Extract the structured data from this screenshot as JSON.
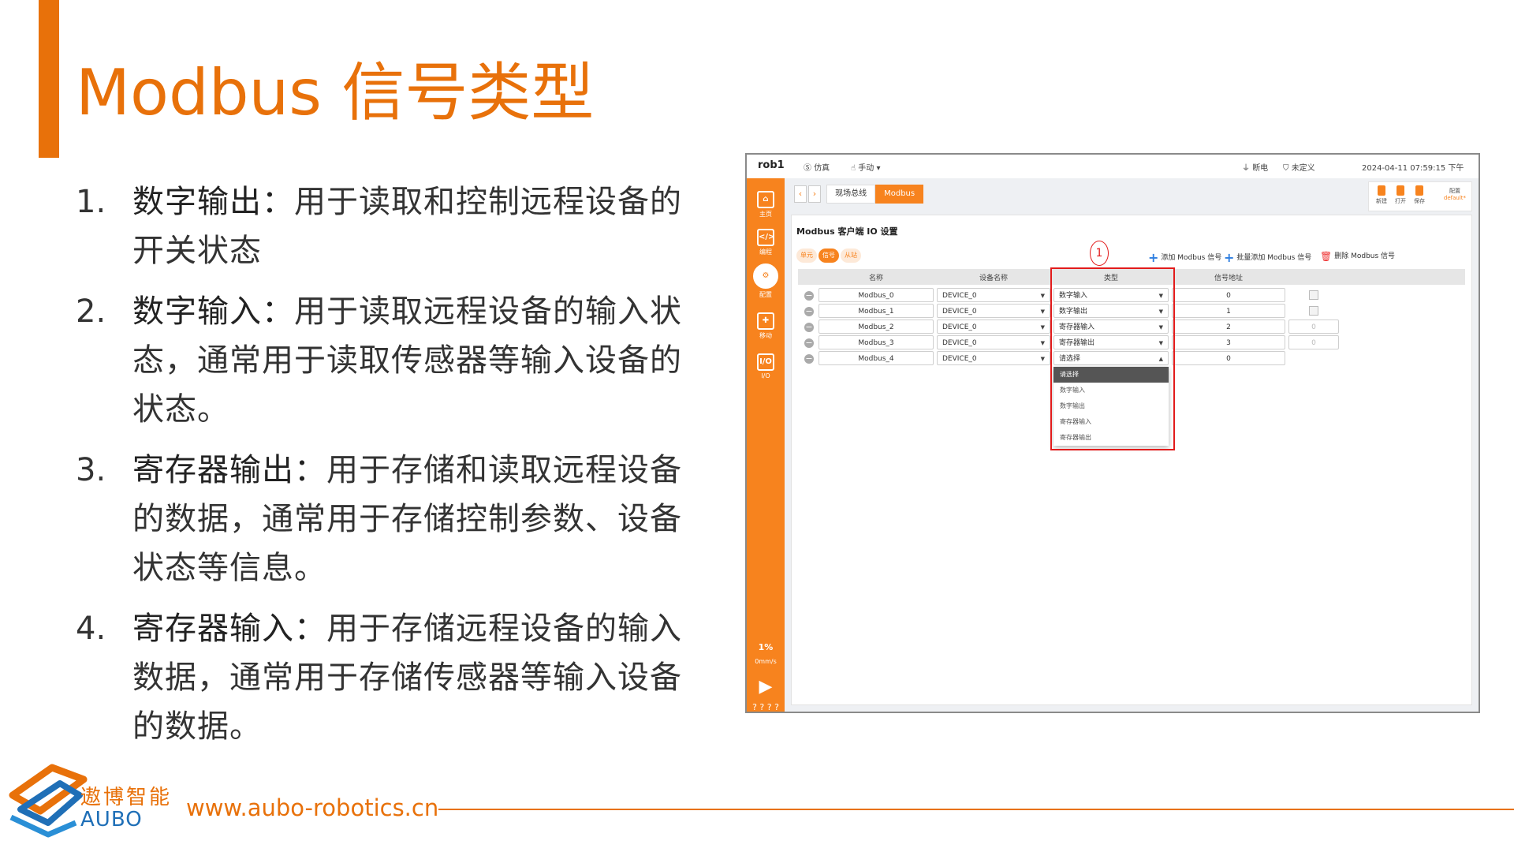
{
  "slide": {
    "title": "Modbus 信号类型",
    "items": [
      {
        "num": "1.",
        "head": "数字输出：",
        "body": "用于读取和控制远程设备的开关状态"
      },
      {
        "num": "2.",
        "head": "数字输入：",
        "body": "用于读取远程设备的输入状态，通常用于读取传感器等输入设备的状态。"
      },
      {
        "num": "3.",
        "head": "寄存器输出：",
        "body": "用于存储和读取远程设备的数据，通常用于存储控制参数、设备状态等信息。"
      },
      {
        "num": "4.",
        "head": "寄存器输入：",
        "body": "用于存储远程设备的输入数据，通常用于存储传感器等输入设备的数据。"
      }
    ],
    "accent_color": "#e8710a"
  },
  "app": {
    "robot": "rob1",
    "topbar": {
      "sim": "仿真",
      "mode": "手动",
      "power": "断电",
      "undefined": "未定义",
      "datetime": "2024-04-11 07:59:15 下午"
    },
    "sidebar": [
      {
        "label": "主页",
        "icon": "home-icon"
      },
      {
        "label": "编程",
        "icon": "code-icon"
      },
      {
        "label": "配置",
        "icon": "config-icon"
      },
      {
        "label": "移动",
        "icon": "move-icon"
      },
      {
        "label": "I/O",
        "icon": "io-icon"
      }
    ],
    "speed_pct": "1%",
    "speed_mm": "0mm/s",
    "bottom_marks": "? ? ? ?",
    "breadcrumbs": [
      "现场总线",
      "Modbus"
    ],
    "file_buttons": [
      "新建",
      "打开",
      "保存"
    ],
    "config_label": "配置",
    "config_value": "default*",
    "panel_title": "Modbus 客户端 IO 设置",
    "pills": [
      "单元",
      "信号",
      "从站"
    ],
    "actions": {
      "add": "添加 Modbus 信号",
      "batch_add": "批量添加 Modbus 信号",
      "delete": "删除 Modbus 信号"
    },
    "columns": [
      "名称",
      "设备名称",
      "类型",
      "信号地址"
    ],
    "rows": [
      {
        "name": "Modbus_0",
        "device": "DEVICE_0",
        "type": "数字输入",
        "addr": "0",
        "extra": ""
      },
      {
        "name": "Modbus_1",
        "device": "DEVICE_0",
        "type": "数字输出",
        "addr": "1",
        "extra": ""
      },
      {
        "name": "Modbus_2",
        "device": "DEVICE_0",
        "type": "寄存器输入",
        "addr": "2",
        "extra": "0"
      },
      {
        "name": "Modbus_3",
        "device": "DEVICE_0",
        "type": "寄存器输出",
        "addr": "3",
        "extra": "0"
      },
      {
        "name": "Modbus_4",
        "device": "DEVICE_0",
        "type": "请选择",
        "addr": "0",
        "extra": ""
      }
    ],
    "dropdown_options": [
      "请选择",
      "数字输入",
      "数字输出",
      "寄存器输入",
      "寄存器输出"
    ],
    "annotation_marker": "1"
  },
  "footer": {
    "brand_cn": "遨博智能",
    "brand_en": "AUBO",
    "url": "www.aubo-robotics.cn"
  }
}
